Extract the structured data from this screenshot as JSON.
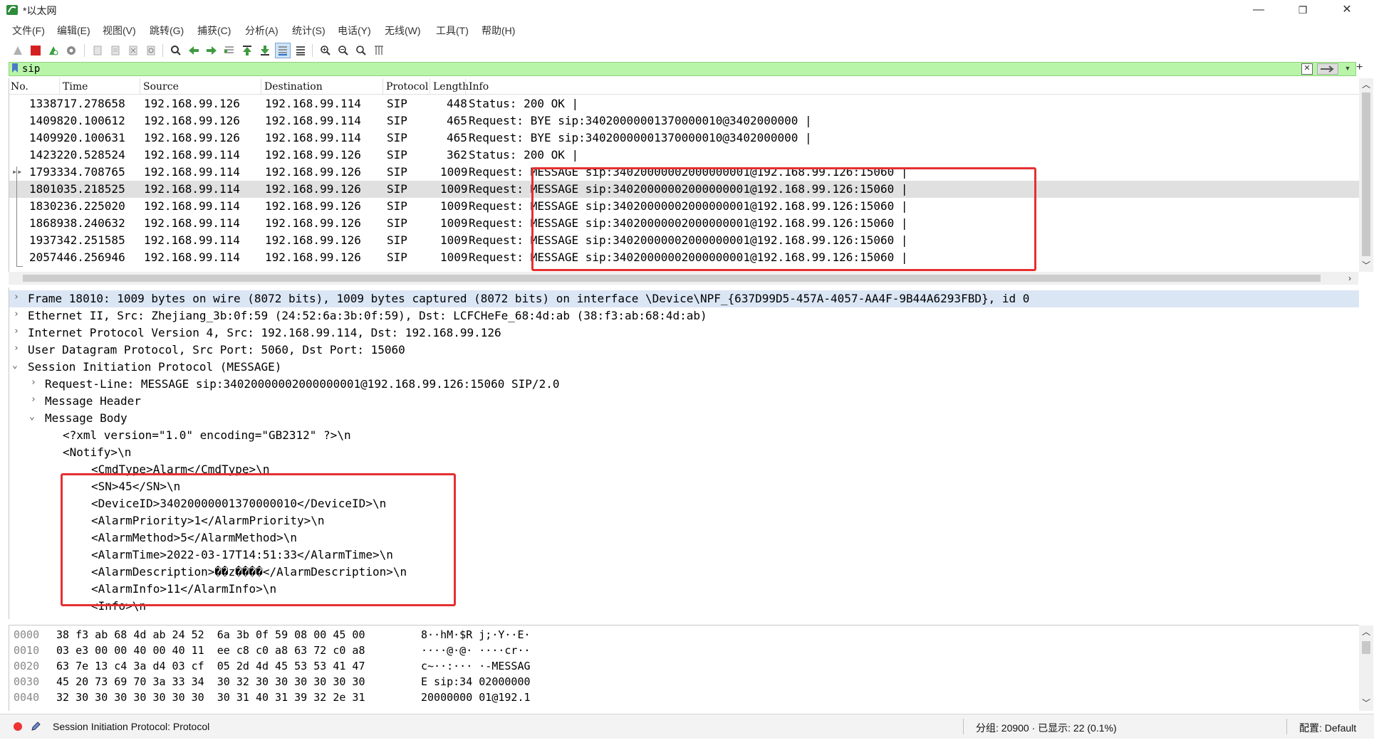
{
  "window": {
    "title": "*以太网",
    "minimize": "—",
    "restore": "❐",
    "close": "✕"
  },
  "menu": [
    "文件(F)",
    "编辑(E)",
    "视图(V)",
    "跳转(G)",
    "捕获(C)",
    "分析(A)",
    "统计(S)",
    "电话(Y)",
    "无线(W)",
    "工具(T)",
    "帮助(H)"
  ],
  "filter": {
    "value": "sip",
    "add": "+"
  },
  "packet_list": {
    "columns": [
      "No.",
      "Time",
      "Source",
      "Destination",
      "Protocol",
      "Length",
      "Info"
    ],
    "rows": [
      {
        "no": "13387",
        "time": "17.278658",
        "src": "192.168.99.126",
        "dst": "192.168.99.114",
        "proto": "SIP",
        "len": "448",
        "info": "Status: 200 OK |"
      },
      {
        "no": "14098",
        "time": "20.100612",
        "src": "192.168.99.126",
        "dst": "192.168.99.114",
        "proto": "SIP",
        "len": "465",
        "info": "Request: BYE sip:34020000001370000010@3402000000 |"
      },
      {
        "no": "14099",
        "time": "20.100631",
        "src": "192.168.99.126",
        "dst": "192.168.99.114",
        "proto": "SIP",
        "len": "465",
        "info": "Request: BYE sip:34020000001370000010@3402000000 |"
      },
      {
        "no": "14232",
        "time": "20.528524",
        "src": "192.168.99.114",
        "dst": "192.168.99.126",
        "proto": "SIP",
        "len": "362",
        "info": "Status: 200 OK |"
      },
      {
        "no": "17933",
        "time": "34.708765",
        "src": "192.168.99.114",
        "dst": "192.168.99.126",
        "proto": "SIP",
        "len": "1009",
        "info": "Request: MESSAGE sip:34020000002000000001@192.168.99.126:15060 |"
      },
      {
        "no": "18010",
        "time": "35.218525",
        "src": "192.168.99.114",
        "dst": "192.168.99.126",
        "proto": "SIP",
        "len": "1009",
        "info": "Request: MESSAGE sip:34020000002000000001@192.168.99.126:15060 |"
      },
      {
        "no": "18302",
        "time": "36.225020",
        "src": "192.168.99.114",
        "dst": "192.168.99.126",
        "proto": "SIP",
        "len": "1009",
        "info": "Request: MESSAGE sip:34020000002000000001@192.168.99.126:15060 |"
      },
      {
        "no": "18689",
        "time": "38.240632",
        "src": "192.168.99.114",
        "dst": "192.168.99.126",
        "proto": "SIP",
        "len": "1009",
        "info": "Request: MESSAGE sip:34020000002000000001@192.168.99.126:15060 |"
      },
      {
        "no": "19373",
        "time": "42.251585",
        "src": "192.168.99.114",
        "dst": "192.168.99.126",
        "proto": "SIP",
        "len": "1009",
        "info": "Request: MESSAGE sip:34020000002000000001@192.168.99.126:15060 |"
      },
      {
        "no": "20574",
        "time": "46.256946",
        "src": "192.168.99.114",
        "dst": "192.168.99.126",
        "proto": "SIP",
        "len": "1009",
        "info": "Request: MESSAGE sip:34020000002000000001@192.168.99.126:15060 |"
      }
    ]
  },
  "details": [
    "Frame 18010: 1009 bytes on wire (8072 bits), 1009 bytes captured (8072 bits) on interface \\Device\\NPF_{637D99D5-457A-4057-AA4F-9B44A6293FBD}, id 0",
    "Ethernet II, Src: Zhejiang_3b:0f:59 (24:52:6a:3b:0f:59), Dst: LCFCHeFe_68:4d:ab (38:f3:ab:68:4d:ab)",
    "Internet Protocol Version 4, Src: 192.168.99.114, Dst: 192.168.99.126",
    "User Datagram Protocol, Src Port: 5060, Dst Port: 15060",
    "Session Initiation Protocol (MESSAGE)",
    "Request-Line: MESSAGE sip:34020000002000000001@192.168.99.126:15060 SIP/2.0",
    "Message Header",
    "Message Body",
    "<?xml version=\"1.0\" encoding=\"GB2312\" ?>\\n",
    "<Notify>\\n",
    "<CmdType>Alarm</CmdType>\\n",
    "<SN>45</SN>\\n",
    "<DeviceID>34020000001370000010</DeviceID>\\n",
    "<AlarmPriority>1</AlarmPriority>\\n",
    "<AlarmMethod>5</AlarmMethod>\\n",
    "<AlarmTime>2022-03-17T14:51:33</AlarmTime>\\n",
    "<AlarmDescription>��z����</AlarmDescription>\\n",
    "<AlarmInfo>11</AlarmInfo>\\n",
    "<Info>\\n"
  ],
  "hex": [
    {
      "off": "0000",
      "bytes": "38 f3 ab 68 4d ab 24 52  6a 3b 0f 59 08 00 45 00",
      "ascii": "8··hM·$R j;·Y··E·"
    },
    {
      "off": "0010",
      "bytes": "03 e3 00 00 40 00 40 11  ee c8 c0 a8 63 72 c0 a8",
      "ascii": "····@·@· ····cr··"
    },
    {
      "off": "0020",
      "bytes": "63 7e 13 c4 3a d4 03 cf  05 2d 4d 45 53 53 41 47",
      "ascii": "c~··:··· ·-MESSAG"
    },
    {
      "off": "0030",
      "bytes": "45 20 73 69 70 3a 33 34  30 32 30 30 30 30 30 30",
      "ascii": "E sip:34 02000000"
    },
    {
      "off": "0040",
      "bytes": "32 30 30 30 30 30 30 30  30 31 40 31 39 32 2e 31",
      "ascii": "20000000 01@192.1"
    }
  ],
  "status": {
    "field": "Session Initiation Protocol: Protocol",
    "packets": "分组: 20900 · 已显示: 22 (0.1%)",
    "profile": "配置: Default"
  },
  "colors": {
    "filter_ok": "#b8f5a8",
    "selected_row": "#e0e0e0",
    "selected_detail": "#dbe6f5",
    "highlight_box": "#e53030"
  }
}
